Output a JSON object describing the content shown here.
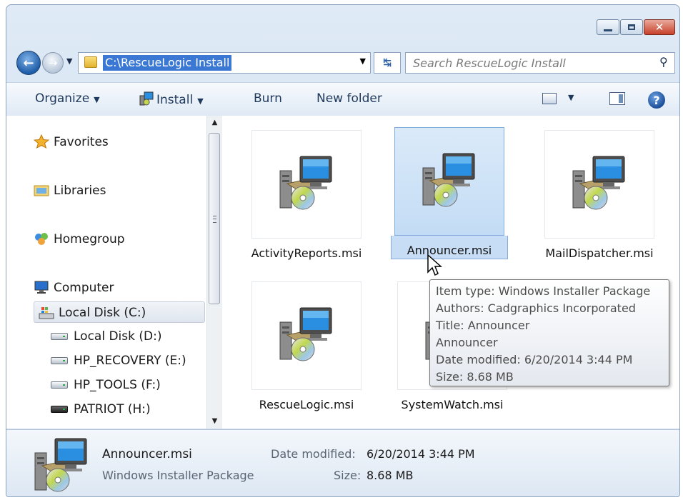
{
  "address": {
    "path": "C:\\RescueLogic Install"
  },
  "search": {
    "placeholder": "Search RescueLogic Install"
  },
  "toolbar": {
    "organize": "Organize",
    "install": "Install",
    "burn": "Burn",
    "new_folder": "New folder"
  },
  "nav": {
    "favorites": "Favorites",
    "libraries": "Libraries",
    "homegroup": "Homegroup",
    "computer": "Computer",
    "drives": [
      {
        "label": "Local Disk (C:)",
        "selected": true
      },
      {
        "label": "Local Disk (D:)",
        "selected": false
      },
      {
        "label": "HP_RECOVERY (E:)",
        "selected": false
      },
      {
        "label": "HP_TOOLS (F:)",
        "selected": false
      },
      {
        "label": "PATRIOT (H:)",
        "selected": false
      }
    ]
  },
  "files": [
    {
      "name": "ActivityReports.msi",
      "selected": false
    },
    {
      "name": "Announcer.msi",
      "selected": true
    },
    {
      "name": "MailDispatcher.msi",
      "selected": false
    },
    {
      "name": "RescueLogic.msi",
      "selected": false
    },
    {
      "name": "SystemWatch.msi",
      "selected": false
    }
  ],
  "tooltip": {
    "item_type": "Item type: Windows Installer Package",
    "authors": "Authors: Cadgraphics Incorporated",
    "title": "Title: Announcer",
    "subject": "Announcer",
    "date_modified": "Date modified: 6/20/2014 3:44 PM",
    "size": "Size: 8.68 MB"
  },
  "details": {
    "name": "Announcer.msi",
    "type": "Windows Installer Package",
    "date_modified_label": "Date modified:",
    "date_modified_value": "6/20/2014 3:44 PM",
    "size_label": "Size:",
    "size_value": "8.68 MB"
  },
  "icons": {
    "file": "windows-installer-package-icon",
    "favorites": "star-icon",
    "libraries": "libraries-icon",
    "homegroup": "homegroup-icon",
    "computer": "computer-icon"
  },
  "colors": {
    "selection": "#c7ddf5",
    "address_highlight": "#3a78d3",
    "close_button": "#c7412a"
  }
}
